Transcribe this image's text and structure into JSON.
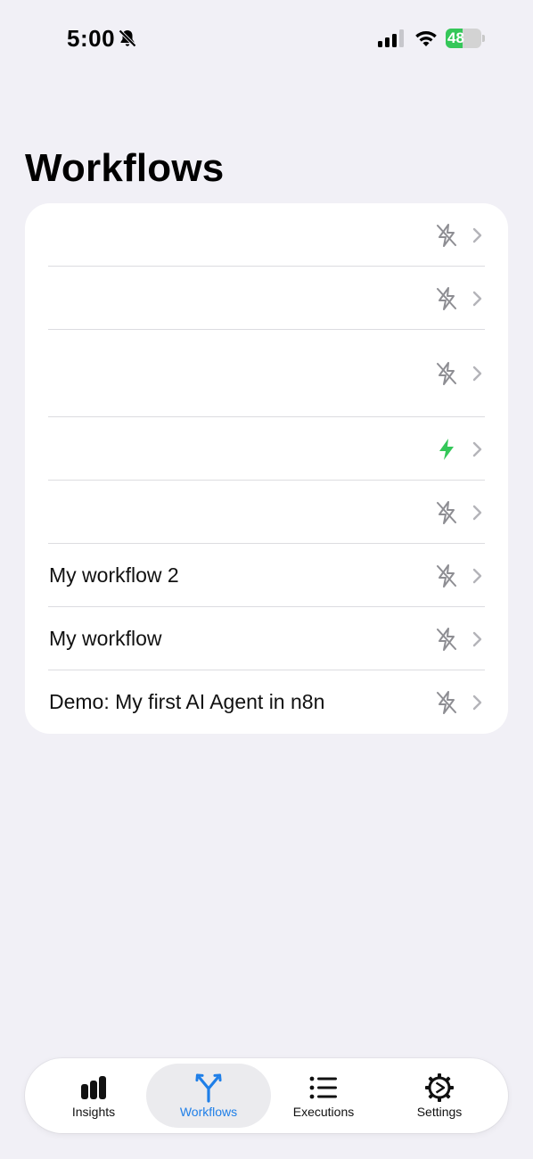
{
  "status_bar": {
    "time": "5:00",
    "battery_text": "48",
    "battery_level": 0.48,
    "icons": [
      "bell-off-icon",
      "signal-icon",
      "wifi-icon",
      "battery-icon"
    ]
  },
  "page": {
    "title": "Workflows"
  },
  "workflows": [
    {
      "label": "",
      "active": false
    },
    {
      "label": "",
      "active": false
    },
    {
      "label": "",
      "active": false
    },
    {
      "label": "",
      "active": true
    },
    {
      "label": "",
      "active": false
    },
    {
      "label": "My workflow 2",
      "active": false
    },
    {
      "label": "My workflow",
      "active": false
    },
    {
      "label": "Demo: My first AI Agent in n8n",
      "active": false
    }
  ],
  "colors": {
    "accent": "#1f7fe8",
    "active_bolt": "#34c759",
    "inactive_bolt": "#8e8e93",
    "background": "#f1f0f6"
  },
  "tab_bar": {
    "tabs": [
      {
        "label": "Insights",
        "icon": "bar-chart-icon"
      },
      {
        "label": "Workflows",
        "icon": "workflow-branch-icon",
        "selected": true
      },
      {
        "label": "Executions",
        "icon": "list-icon"
      },
      {
        "label": "Settings",
        "icon": "gear-icon"
      }
    ]
  }
}
